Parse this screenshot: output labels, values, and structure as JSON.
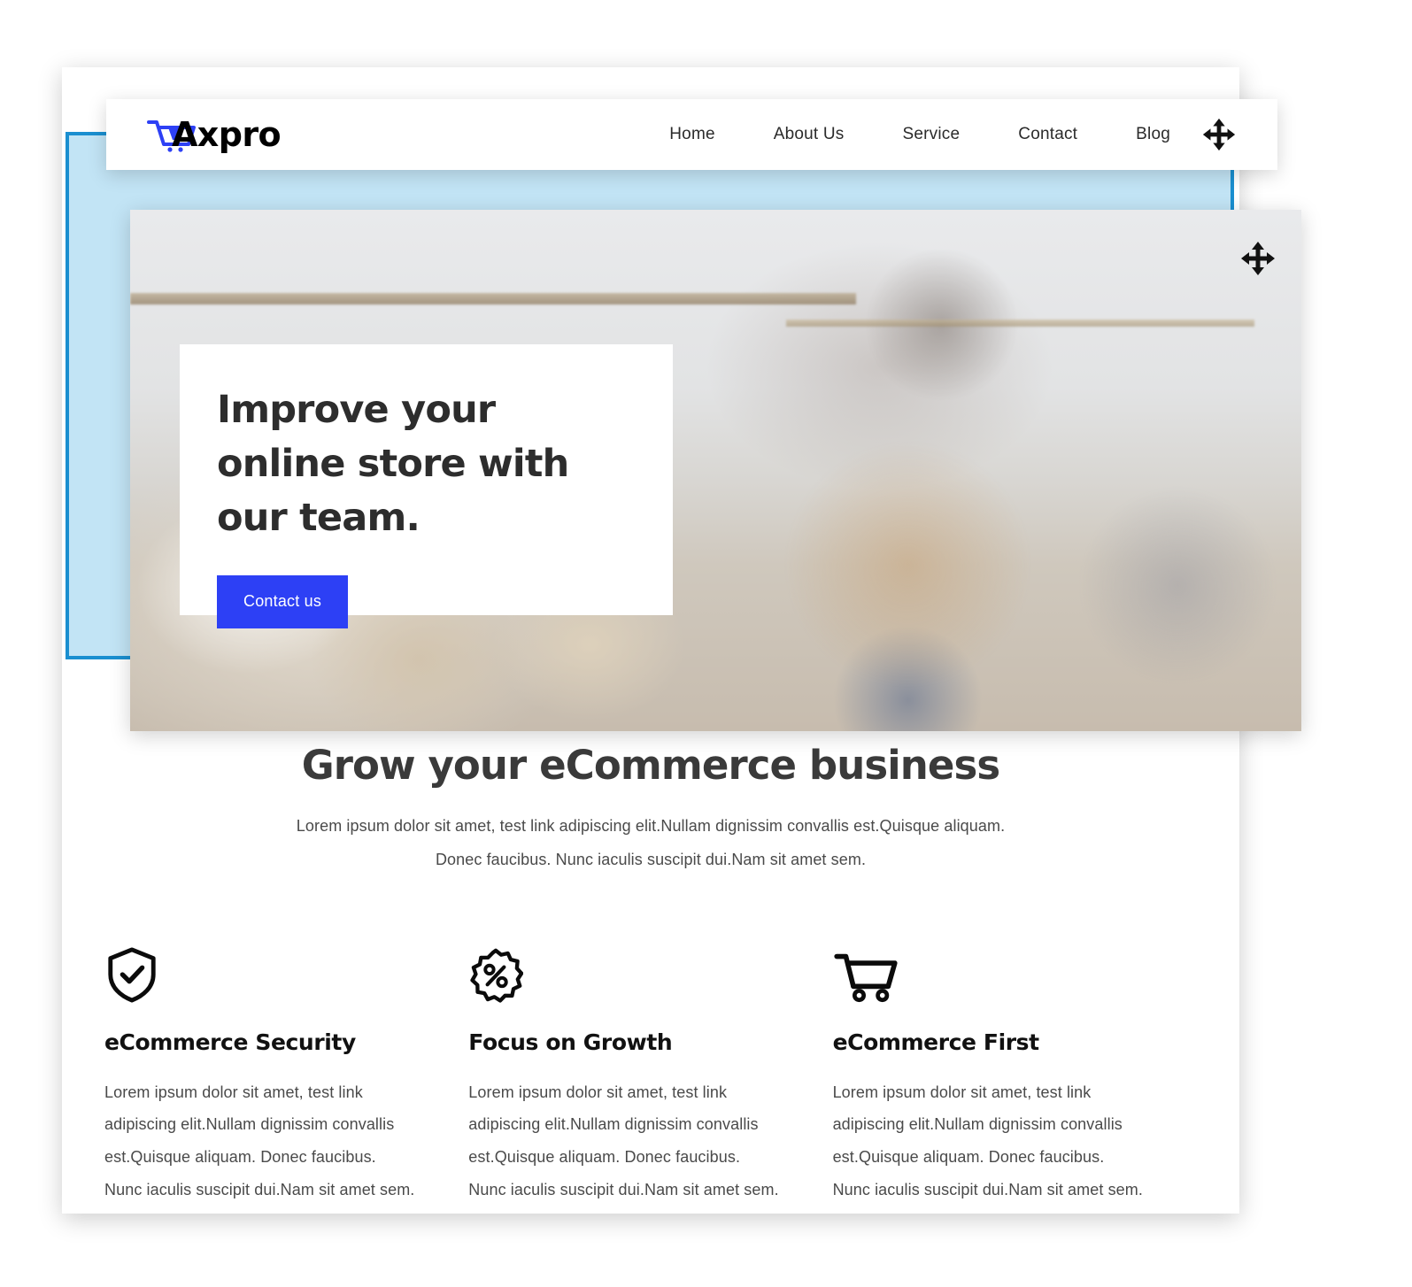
{
  "brand": {
    "name": "Axpro",
    "logo_icon": "shopping-cart-icon",
    "logo_color": "#2d40f5"
  },
  "nav": {
    "items": [
      {
        "label": "Home"
      },
      {
        "label": "About Us"
      },
      {
        "label": "Service"
      },
      {
        "label": "Contact"
      },
      {
        "label": "Blog"
      }
    ],
    "move_handle_icon": "move-arrows-icon"
  },
  "hero": {
    "title": "Improve your online store with our team.",
    "cta_label": "Contact us",
    "cta_color": "#2d40f5",
    "move_handle_icon": "move-arrows-icon"
  },
  "section": {
    "title": "Grow your eCommerce business",
    "subtitle_line1": "Lorem ipsum dolor sit amet, test link adipiscing elit.Nullam dignissim convallis est.Quisque aliquam.",
    "subtitle_line2": "Donec faucibus. Nunc iaculis suscipit dui.Nam sit amet sem."
  },
  "features": [
    {
      "icon": "shield-check-icon",
      "title": "eCommerce Security",
      "body": "Lorem ipsum dolor sit amet, test link adipiscing elit.Nullam dignissim convallis est.Quisque aliquam. Donec faucibus. Nunc iaculis suscipit dui.Nam sit amet sem."
    },
    {
      "icon": "discount-percent-badge-icon",
      "title": "Focus on Growth",
      "body": "Lorem ipsum dolor sit amet, test link adipiscing elit.Nullam dignissim convallis est.Quisque aliquam. Donec faucibus. Nunc iaculis suscipit dui.Nam sit amet sem."
    },
    {
      "icon": "shopping-cart-icon",
      "title": "eCommerce First",
      "body": "Lorem ipsum dolor sit amet, test link adipiscing elit.Nullam dignissim convallis est.Quisque aliquam. Donec faucibus. Nunc iaculis suscipit dui.Nam sit amet sem."
    }
  ],
  "decor": {
    "accent_box_fill": "#c2e4f5",
    "accent_box_border": "#1a8fd0"
  }
}
